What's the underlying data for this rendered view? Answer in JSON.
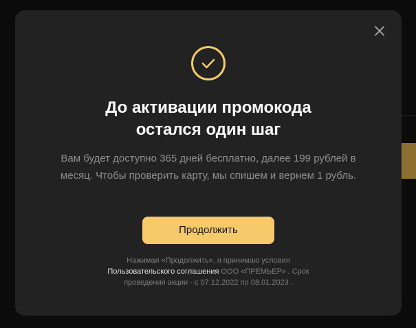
{
  "modal": {
    "title_line1": "До активации промокода",
    "title_line2": "остался один шаг",
    "description": "Вам будет доступно 365 дней бесплатно, далее 199 рублей в месяц. Чтобы проверить карту, мы спишем и вернем 1 рубль.",
    "continue_label": "Продолжить",
    "legal": {
      "prefix": "Нажимая «Продолжить», я принимаю условия",
      "link_text": "Пользовательского соглашения",
      "suffix": " ООО «ПРЕМЬЕР» . Срок проведения акции - с 07.12.2022 по 08.01.2023 ."
    },
    "icons": {
      "close": "close-icon",
      "success": "check-circle-icon"
    }
  },
  "colors": {
    "accent": "#f6c96a",
    "modal_bg": "#222222",
    "page_bg": "#0b0b0b",
    "title": "#ffffff",
    "muted_text": "#8e8e8e"
  }
}
